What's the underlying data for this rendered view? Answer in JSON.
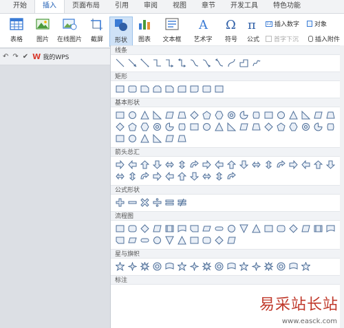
{
  "tabs": [
    "开始",
    "插入",
    "页面布局",
    "引用",
    "审阅",
    "视图",
    "章节",
    "开发工具",
    "特色功能"
  ],
  "active_tab": "插入",
  "ribbon": {
    "table": "表格",
    "picture": "图片",
    "online_picture": "在线图片",
    "screenshot": "截屏",
    "shape": "形状",
    "chart": "图表",
    "textbox": "文本框",
    "wordart": "艺术字",
    "symbol": "符号",
    "formula": "公式",
    "insert_number": "插入数字",
    "object": "对象",
    "first_char_drop": "首字下沉",
    "insert_attachment": "插入附件"
  },
  "quickbar": {
    "doc_label": "我的WPS"
  },
  "panel": {
    "sections": [
      {
        "title": "线条",
        "count": 12
      },
      {
        "title": "矩形",
        "count": 9
      },
      {
        "title": "基本形状",
        "count": 42
      },
      {
        "title": "箭头总汇",
        "count": 28
      },
      {
        "title": "公式形状",
        "count": 6
      },
      {
        "title": "流程图",
        "count": 28
      },
      {
        "title": "星与旗帜",
        "count": 16
      },
      {
        "title": "标注",
        "count": 0
      }
    ]
  },
  "watermark": {
    "text": "易采站长站",
    "url": "www.easck.com"
  },
  "colors": {
    "accent": "#1a5bb3",
    "shape_stroke": "#4f6f98",
    "watermark": "#c0392b"
  }
}
